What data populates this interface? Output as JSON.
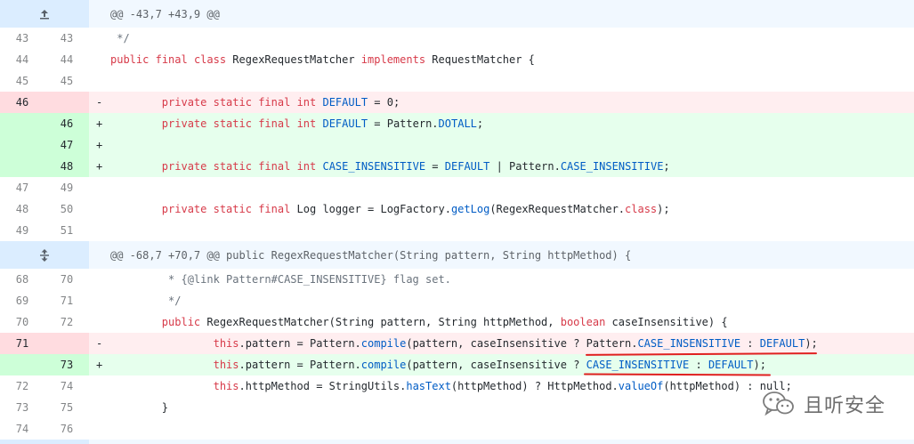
{
  "hunks": [
    {
      "header": "@@ -43,7 +43,9 @@",
      "expander_icon": "expand-up-icon",
      "lines": [
        {
          "type": "ctx",
          "old": "43",
          "new": "43",
          "marker": " ",
          "code": " */"
        },
        {
          "type": "ctx",
          "old": "44",
          "new": "44",
          "marker": " ",
          "code": "public final class RegexRequestMatcher implements RequestMatcher {"
        },
        {
          "type": "ctx",
          "old": "45",
          "new": "45",
          "marker": " ",
          "code": ""
        },
        {
          "type": "del",
          "old": "46",
          "new": "",
          "marker": "-",
          "code": "        private static final int DEFAULT = 0;"
        },
        {
          "type": "add",
          "old": "",
          "new": "46",
          "marker": "+",
          "code": "        private static final int DEFAULT = Pattern.DOTALL;"
        },
        {
          "type": "add",
          "old": "",
          "new": "47",
          "marker": "+",
          "code": ""
        },
        {
          "type": "add",
          "old": "",
          "new": "48",
          "marker": "+",
          "code": "        private static final int CASE_INSENSITIVE = DEFAULT | Pattern.CASE_INSENSITIVE;"
        },
        {
          "type": "ctx",
          "old": "47",
          "new": "49",
          "marker": " ",
          "code": ""
        },
        {
          "type": "ctx",
          "old": "48",
          "new": "50",
          "marker": " ",
          "code": "        private static final Log logger = LogFactory.getLog(RegexRequestMatcher.class);"
        },
        {
          "type": "ctx",
          "old": "49",
          "new": "51",
          "marker": " ",
          "code": ""
        }
      ]
    },
    {
      "header": "@@ -68,7 +70,7 @@ public RegexRequestMatcher(String pattern, String httpMethod) {",
      "expander_icon": "expand-both-icon",
      "lines": [
        {
          "type": "ctx",
          "old": "68",
          "new": "70",
          "marker": " ",
          "code": "         * {@link Pattern#CASE_INSENSITIVE} flag set."
        },
        {
          "type": "ctx",
          "old": "69",
          "new": "71",
          "marker": " ",
          "code": "         */"
        },
        {
          "type": "ctx",
          "old": "70",
          "new": "72",
          "marker": " ",
          "code": "        public RegexRequestMatcher(String pattern, String httpMethod, boolean caseInsensitive) {"
        },
        {
          "type": "del",
          "old": "71",
          "new": "",
          "marker": "-",
          "code": "                this.pattern = Pattern.compile(pattern, caseInsensitive ? Pattern.CASE_INSENSITIVE : DEFAULT);"
        },
        {
          "type": "add",
          "old": "",
          "new": "73",
          "marker": "+",
          "code": "                this.pattern = Pattern.compile(pattern, caseInsensitive ? CASE_INSENSITIVE : DEFAULT);"
        },
        {
          "type": "ctx",
          "old": "72",
          "new": "74",
          "marker": " ",
          "code": "                this.httpMethod = StringUtils.hasText(httpMethod) ? HttpMethod.valueOf(httpMethod) : null;"
        },
        {
          "type": "ctx",
          "old": "73",
          "new": "75",
          "marker": " ",
          "code": "        }"
        },
        {
          "type": "ctx",
          "old": "74",
          "new": "76",
          "marker": " ",
          "code": ""
        }
      ]
    }
  ],
  "watermark": {
    "text": "且听安全",
    "icon": "wechat-icon"
  },
  "colors": {
    "add_bg": "#e6ffed",
    "del_bg": "#ffeef0",
    "hunk_bg": "#f1f8ff",
    "keyword": "#d73a49",
    "constant": "#005cc5",
    "annotation": "#e02020"
  }
}
